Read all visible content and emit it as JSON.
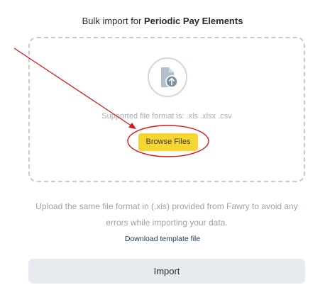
{
  "header": {
    "title_prefix": "Bulk import for ",
    "title_bold": "Periodic Pay Elements"
  },
  "dropzone": {
    "icon": "file-upload-icon",
    "supported_formats": "Supported file format is: .xls .xlsx .csv",
    "browse_label": "Browse Files"
  },
  "note": {
    "text": "Upload the same file format in (.xls) provided from Fawry to avoid any errors while importing your data."
  },
  "download_template_label": "Download template file",
  "import_label": "Import",
  "colors": {
    "browse_button": "#f7d632",
    "import_button": "#e7eaee",
    "annotation": "#d81a1a",
    "link": "#1f3a60"
  }
}
